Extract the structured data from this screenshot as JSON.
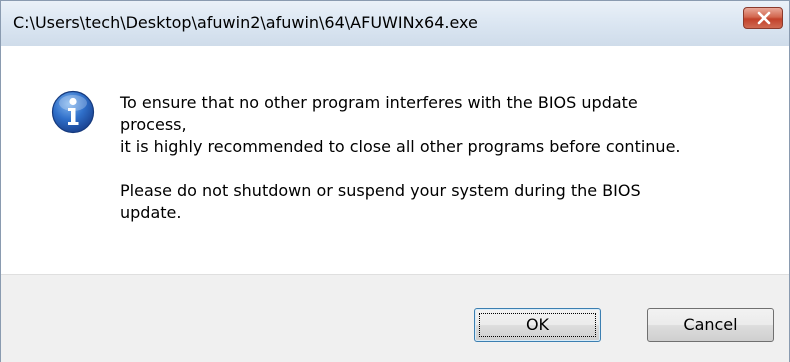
{
  "window": {
    "title": "C:\\Users\\tech\\Desktop\\afuwin2\\afuwin\\64\\AFUWINx64.exe"
  },
  "titlebar": {
    "close_icon": "close-icon"
  },
  "message": {
    "icon": "info-icon",
    "paragraph1_line1": "To ensure that no other program interferes with the BIOS update",
    "paragraph1_line2": "process,",
    "paragraph1_line3": "it is highly recommended to close all other programs before continue.",
    "paragraph2_line1": "Please do not shutdown or suspend your system during the BIOS",
    "paragraph2_line2": "update."
  },
  "buttons": {
    "ok_label": "OK",
    "cancel_label": "Cancel"
  },
  "colors": {
    "close_button": "#c2412a",
    "info_icon": "#2a5db0",
    "footer_background": "#f0f0f0"
  }
}
